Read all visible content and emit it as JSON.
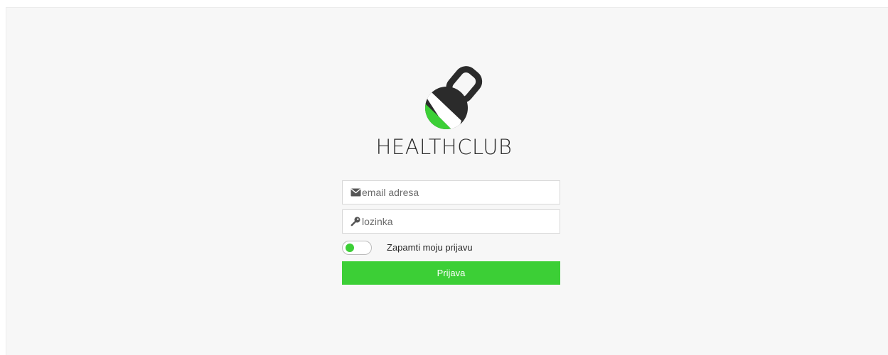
{
  "brand": {
    "name": "HEALTHCLUB",
    "logo_icon": "kettlebell-icon",
    "colors": {
      "accent": "#3ccf36",
      "dark": "#2b2b2b"
    }
  },
  "login": {
    "email_placeholder": "email adresa",
    "email_icon": "envelope-icon",
    "password_placeholder": "lozinka",
    "password_icon": "key-icon",
    "remember_label": "Zapamti moju prijavu",
    "remember_checked": true,
    "submit_label": "Prijava"
  }
}
